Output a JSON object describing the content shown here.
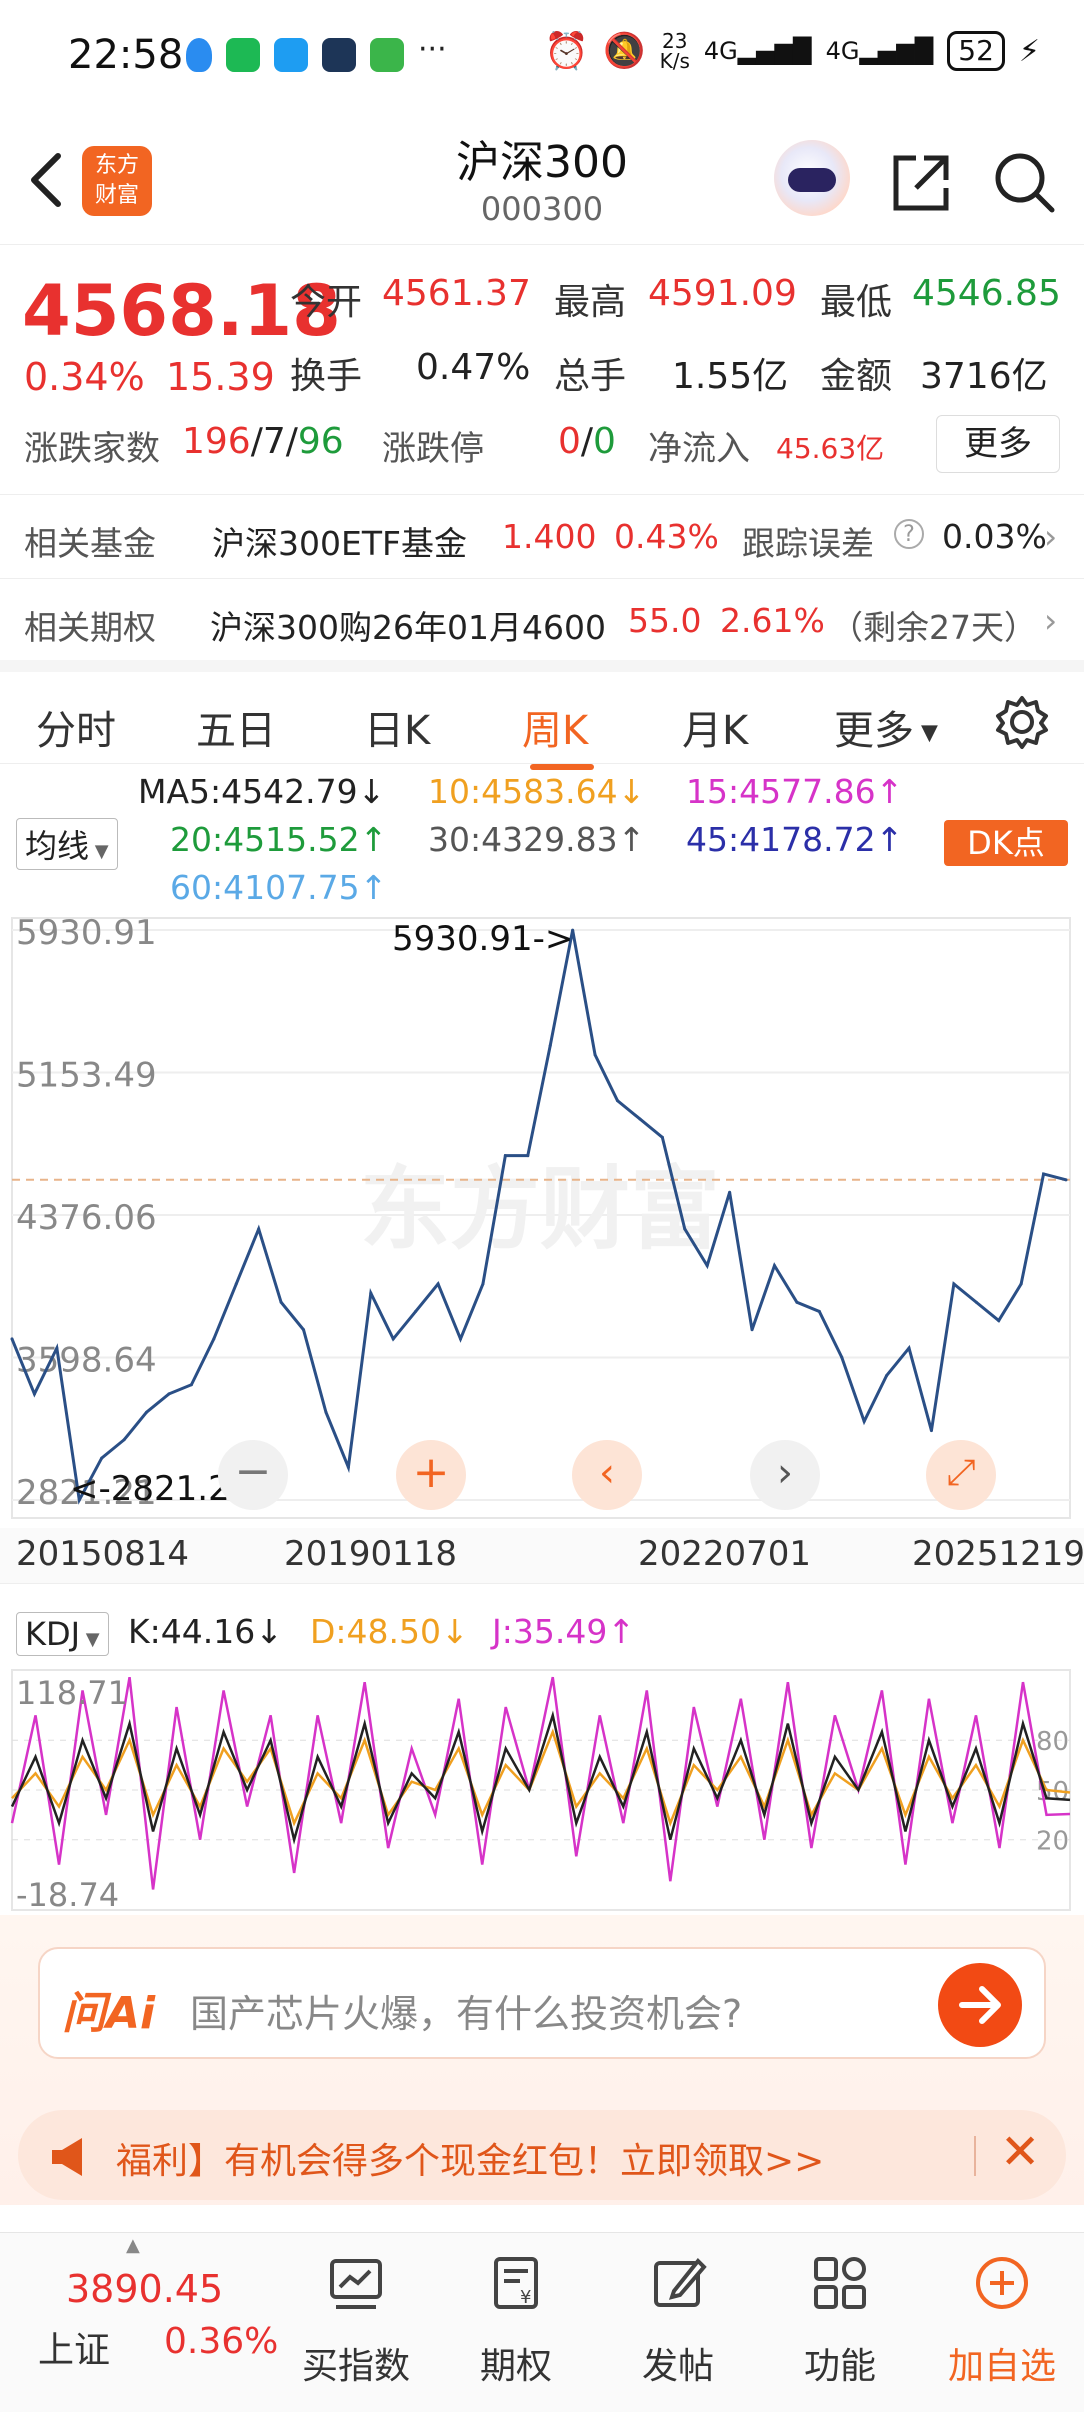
{
  "status_bar": {
    "time": "22:58",
    "net_speed_top": "23",
    "net_speed_bottom": "K/s",
    "signal1": "4G",
    "signal2": "4G",
    "battery": "52"
  },
  "header": {
    "logo_line1": "东方",
    "logo_line2": "财富",
    "title": "沪深300",
    "code": "000300"
  },
  "quote": {
    "price": "4568.18",
    "change_pct": "0.34%",
    "change_abs": "15.39",
    "open_label": "今开",
    "open": "4561.37",
    "high_label": "最高",
    "high": "4591.09",
    "low_label": "最低",
    "low": "4546.85",
    "turnover_label": "换手",
    "turnover": "0.47%",
    "volume_label": "总手",
    "volume": "1.55亿",
    "amount_label": "金额",
    "amount": "3716亿",
    "updown_label": "涨跌家数",
    "up_count": "196",
    "flat_count": "7",
    "down_count": "96",
    "limit_label": "涨跌停",
    "limit_up": "0",
    "limit_down": "0",
    "netflow_label": "净流入",
    "netflow": "45.63亿",
    "more_button": "更多"
  },
  "related_fund": {
    "label": "相关基金",
    "name": "沪深300ETF基金",
    "price": "1.400",
    "pct": "0.43%",
    "tracking_label": "跟踪误差",
    "tracking_value": "0.03%"
  },
  "related_option": {
    "label": "相关期权",
    "name": "沪深300购26年01月4600",
    "price": "55.0",
    "pct": "2.61%",
    "remain": "（剩余27天）"
  },
  "tabs": [
    "分时",
    "五日",
    "日K",
    "周K",
    "月K",
    "更多"
  ],
  "active_tab": "周K",
  "ma_legend": {
    "selector": "均线",
    "ma5": "MA5:4542.79↓",
    "ma10": "10:4583.64↓",
    "ma15": "15:4577.86↑",
    "ma20": "20:4515.52↑",
    "ma30": "30:4329.83↑",
    "ma45": "45:4178.72↑",
    "ma60": "60:4107.75↑",
    "dk_button": "DK点",
    "colors": {
      "ma5": "#222222",
      "ma10": "#f0a020",
      "ma15": "#d633c8",
      "ma20": "#1e9b3b",
      "ma30": "#555555",
      "ma45": "#2b2fa8",
      "ma60": "#5aa9e6"
    }
  },
  "chart_data": [
    {
      "type": "line",
      "title": "",
      "y_ticks": [
        "5930.91",
        "5153.49",
        "4376.06",
        "3598.64",
        "2821.21"
      ],
      "x_ticks": [
        "20150814",
        "20190118",
        "20220701",
        "20251219"
      ],
      "ylim": [
        2821.21,
        5930.91
      ],
      "max_annotation": "5930.91->",
      "min_annotation": "<-2821.21",
      "reference_line": 4568.18,
      "watermark": "东方财富",
      "series": [
        {
          "x": [
            "20150814",
            "2015-10",
            "2015-12",
            "2016-02",
            "2016-04",
            "2016-07",
            "2016-10",
            "2017-01",
            "2017-04",
            "2017-07",
            "2017-10",
            "2018-01",
            "2018-02",
            "2018-05",
            "2018-08",
            "20190118",
            "2019-04",
            "2019-06",
            "2019-09",
            "2019-12",
            "2020-03",
            "2020-05",
            "2020-07",
            "2020-10",
            "2021-01",
            "2021-02",
            "2021-05",
            "2021-08",
            "2021-11",
            "2022-01",
            "2022-03",
            "2022-05",
            "20220701",
            "2022-10",
            "2023-01",
            "2023-04",
            "2023-07",
            "2023-10",
            "2024-01",
            "2024-02",
            "2024-05",
            "2024-08",
            "2024-10",
            "2025-01",
            "2025-04",
            "2025-07",
            "2025-10",
            "20251219"
          ],
          "values": [
            3700,
            3400,
            3650,
            2821,
            3050,
            3150,
            3300,
            3400,
            3450,
            3700,
            4000,
            4300,
            3900,
            3750,
            3300,
            3000,
            3950,
            3700,
            3850,
            4000,
            3700,
            4000,
            4700,
            4700,
            5300,
            5930,
            5250,
            5000,
            4900,
            4800,
            4300,
            4100,
            4500,
            3750,
            4100,
            3900,
            3850,
            3600,
            3250,
            3500,
            3650,
            3200,
            4000,
            3900,
            3800,
            4000,
            4600,
            4568
          ]
        }
      ]
    },
    {
      "type": "line",
      "title": "",
      "y_ticks": [
        "118.71",
        "-18.74"
      ],
      "ylim": [
        -18.74,
        118.71
      ],
      "right_ticks": [
        "80",
        "50",
        "20"
      ],
      "indicator": "KDJ",
      "series": [
        {
          "name": "K:44.16↓",
          "color": "#222222",
          "values": [
            40,
            70,
            30,
            80,
            45,
            90,
            25,
            75,
            35,
            85,
            50,
            80,
            20,
            70,
            40,
            90,
            30,
            60,
            45,
            85,
            25,
            75,
            50,
            95,
            30,
            70,
            40,
            85,
            20,
            75,
            45,
            80,
            35,
            90,
            30,
            70,
            50,
            85,
            25,
            80,
            40,
            75,
            30,
            90,
            45,
            44
          ]
        },
        {
          "name": "D:48.50↓",
          "color": "#f0a020",
          "values": [
            45,
            60,
            40,
            70,
            50,
            80,
            35,
            65,
            40,
            75,
            55,
            75,
            30,
            60,
            45,
            80,
            35,
            55,
            50,
            75,
            35,
            65,
            50,
            85,
            40,
            60,
            45,
            75,
            30,
            65,
            50,
            70,
            40,
            80,
            35,
            60,
            50,
            75,
            35,
            70,
            45,
            65,
            40,
            80,
            50,
            48.5
          ]
        },
        {
          "name": "J:35.49↑",
          "color": "#d633c8",
          "values": [
            30,
            95,
            5,
            110,
            35,
            118,
            -10,
            100,
            20,
            110,
            40,
            95,
            0,
            95,
            30,
            115,
            15,
            75,
            35,
            105,
            5,
            100,
            50,
            118,
            10,
            95,
            30,
            110,
            -5,
            100,
            40,
            105,
            20,
            115,
            15,
            95,
            50,
            110,
            5,
            105,
            30,
            95,
            15,
            115,
            35,
            35.49
          ]
        }
      ]
    }
  ],
  "chart_controls": {
    "overlay_buttons": [
      "minus-button",
      "plus-button",
      "prev-button",
      "next-button",
      "expand-button"
    ]
  },
  "kdj": {
    "selector": "KDJ",
    "k": "K:44.16↓",
    "d": "D:48.50↓",
    "j": "J:35.49↑"
  },
  "ask_ai": {
    "brand": "问Ai",
    "placeholder": "国产芯片火爆，有什么投资机会?"
  },
  "banner": {
    "text": "福利】有机会得多个现金红包！立即领取>>"
  },
  "bottom_nav": {
    "index_name": "上证",
    "index_value": "3890.45",
    "index_pct": "0.36%",
    "items": [
      "买指数",
      "期权",
      "发帖",
      "功能",
      "加自选"
    ]
  }
}
